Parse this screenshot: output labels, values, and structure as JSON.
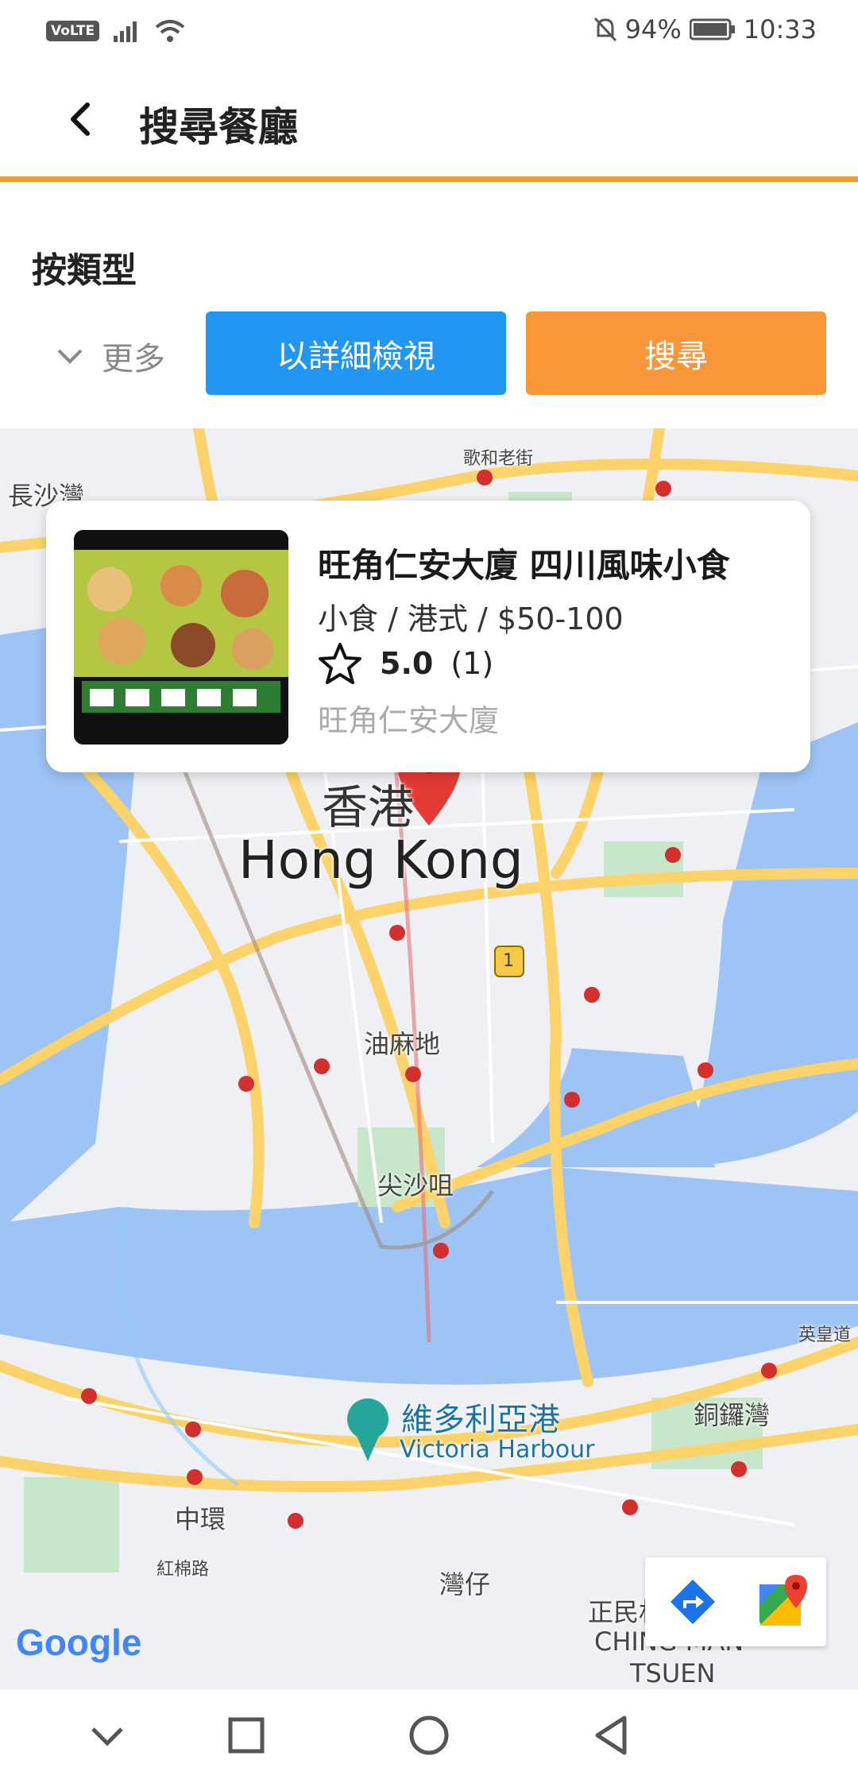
{
  "status_bar": {
    "volte_label": "VoLTE",
    "battery": "94%",
    "time": "10:33",
    "icons": [
      "signal-icon",
      "wifi-icon",
      "mute-icon",
      "battery-icon"
    ]
  },
  "header": {
    "title": "搜尋餐廳",
    "back_icon": "back-arrow-icon"
  },
  "filter": {
    "label": "按類型",
    "more_label": "更多",
    "detail_button": "以詳細檢視",
    "search_button": "搜尋"
  },
  "restaurant_card": {
    "name": "旺角仁安大廈 四川風味小食",
    "category": "小食 / 港式 / $50-100",
    "rating": "5.0",
    "review_count": "(1)",
    "address": "旺角仁安大廈"
  },
  "map": {
    "labels": {
      "hk_cn": "香港",
      "hk_en": "Hong Kong",
      "yau_ma_tei": "油麻地",
      "tsim_sha_tsui": "尖沙咀",
      "harbour_cn": "維多利亞港",
      "harbour_en": "Victoria Harbour",
      "central": "中環",
      "wan_chai": "灣仔",
      "causeway_bay": "銅鑼灣",
      "cheung_sha_wan": "長沙灣",
      "arran_street": "歌和老街",
      "ying_wong": "英皇道",
      "cotton_tree": "紅棉路",
      "ching_man": "正民村",
      "ching_man_en_1": "CHING MAN",
      "ching_man_en_2": "TSUEN",
      "route_1": "1",
      "google": "Google"
    },
    "colors": {
      "water": "#9ec3f5",
      "land": "#eef0f3",
      "major_road": "#fcd36a",
      "pin": "#e53935"
    }
  },
  "colors": {
    "accent": "#f3993a",
    "detail_button": "#2196f3",
    "search_button": "#f9963a"
  }
}
